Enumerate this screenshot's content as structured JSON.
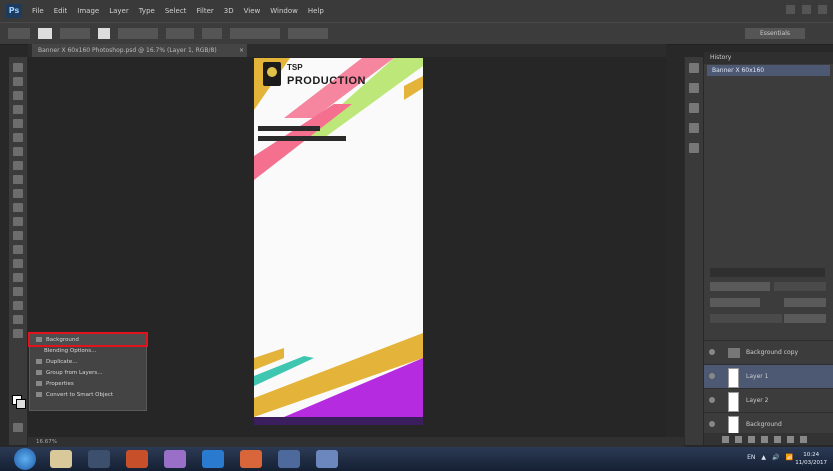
{
  "app": {
    "logo": "Ps",
    "menus": [
      "File",
      "Edit",
      "Image",
      "Layer",
      "Type",
      "Select",
      "Filter",
      "3D",
      "View",
      "Window",
      "Help"
    ]
  },
  "options": {
    "workspace": "Essentials"
  },
  "document": {
    "tab_title": "Banner X 60x160 Photoshop.psd @ 16.7% (Layer 1, RGB/8)",
    "close": "×"
  },
  "canvas": {
    "brand_line1": "TSP",
    "brand_line2": "PRODUCTION",
    "colors": {
      "yellow": "#e4b43a",
      "pink": "#f4708e",
      "green": "#b6e46a",
      "magenta": "#b42be0",
      "teal": "#3ec6b0",
      "violet": "#3a1e5e"
    }
  },
  "context_menu": {
    "items": [
      "Background",
      "Blending Options...",
      "Duplicate...",
      "Group from Layers...",
      "Properties",
      "Convert to Smart Object"
    ]
  },
  "history": {
    "title": "History",
    "row": "Banner X 60x160"
  },
  "layers": {
    "items": [
      {
        "name": "Background copy"
      },
      {
        "name": "Layer 1"
      },
      {
        "name": "Layer 2"
      },
      {
        "name": "Background"
      }
    ]
  },
  "status": {
    "zoom": "16.67%"
  },
  "taskbar": {
    "tray": [
      "EN",
      "▲",
      "🔊",
      "📶"
    ],
    "time": "10:24",
    "date": "11/03/2017"
  }
}
